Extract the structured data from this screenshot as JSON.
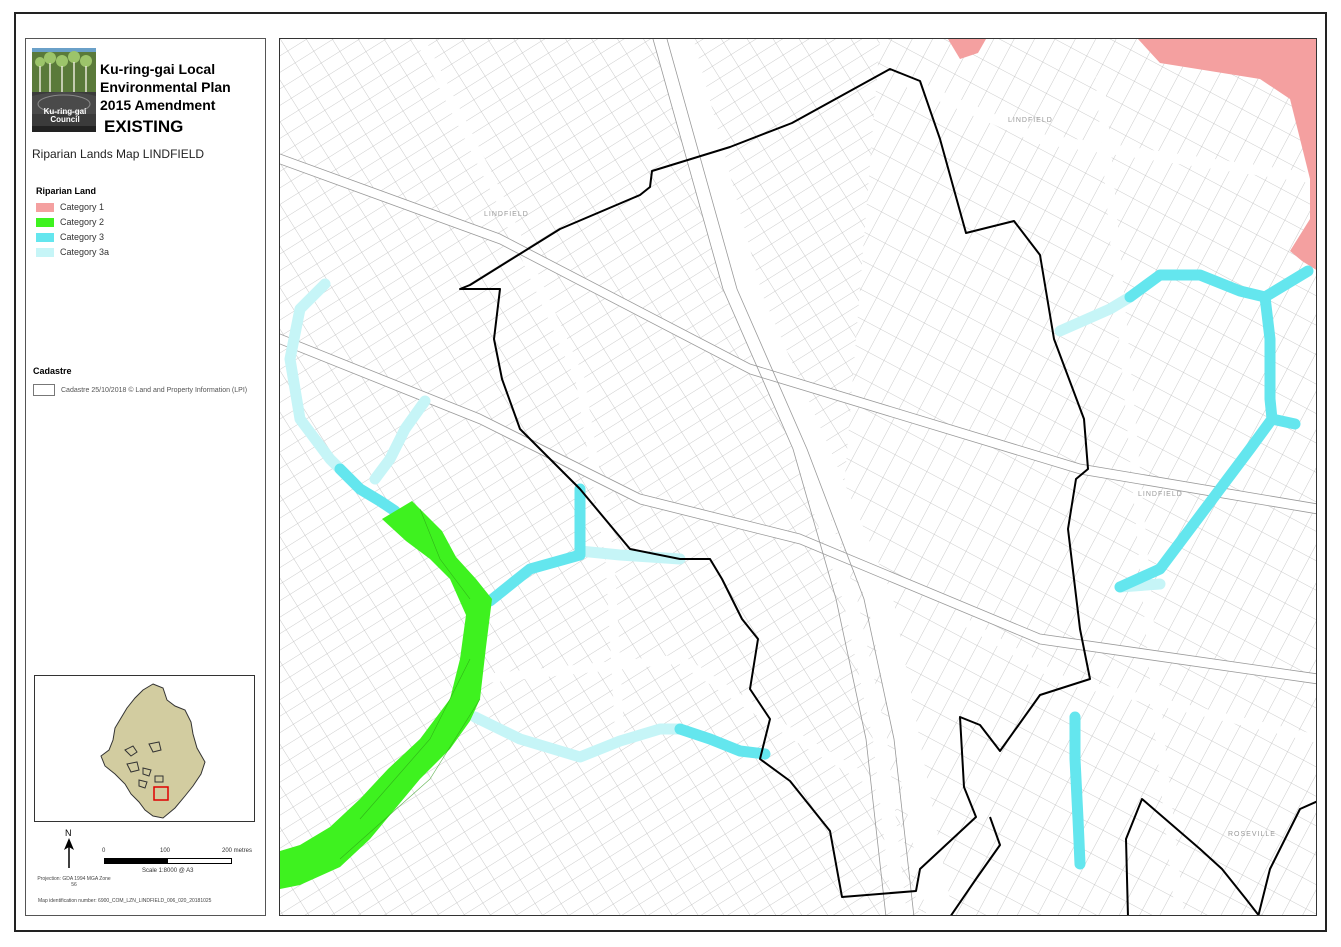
{
  "header": {
    "title_line1": "Ku-ring-gai Local",
    "title_line2": "Environmental Plan",
    "title_line3": "2015 Amendment",
    "status": "EXISTING",
    "subtitle": "Riparian Lands Map LINDFIELD",
    "logo_text": "Ku-ring-gai Council"
  },
  "legend": {
    "section_title": "Riparian Land",
    "items": [
      {
        "label": "Category 1",
        "color": "#f4a0a0"
      },
      {
        "label": "Category 2",
        "color": "#3ef21f"
      },
      {
        "label": "Category 3",
        "color": "#64e6ee"
      },
      {
        "label": "Category 3a",
        "color": "#c6f5f7"
      }
    ],
    "cadastre_title": "Cadastre",
    "cadastre_label": "Cadastre 25/10/2018 © Land and Property Information (LPI)"
  },
  "scale": {
    "ticks": [
      "0",
      "100",
      "200 metres"
    ],
    "label": "Scale  1:8000  @ A3"
  },
  "north_label": "N",
  "projection": "Projection: GDA 1994 MGA Zone 56",
  "map_identification": "Map identification number:  6900_COM_LZN_LINDFIELD_006_020_20181025",
  "street_labels": [
    "LINDFIELD",
    "LINDFIELD",
    "LINDFIELD",
    "ROSEVILLE"
  ],
  "colors": {
    "category1": "#f4a0a0",
    "category2": "#3ef21f",
    "category3": "#64e6ee",
    "category3a": "#c6f5f7",
    "boundary": "#000000",
    "cadastre": "#b8b8b8"
  }
}
